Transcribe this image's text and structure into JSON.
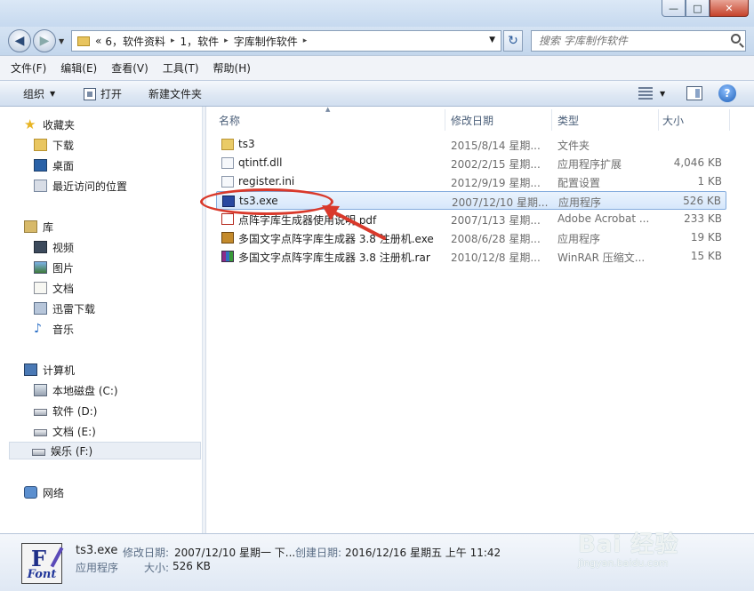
{
  "window": {
    "minimize_glyph": "—",
    "maximize_glyph": "□",
    "close_glyph": "✕"
  },
  "address": {
    "overflow": "«",
    "crumbs": [
      "6，软件资料",
      "1，软件",
      "字库制作软件"
    ],
    "separator": "▸"
  },
  "search": {
    "placeholder": "搜索 字库制作软件"
  },
  "menu": [
    "文件(F)",
    "编辑(E)",
    "查看(V)",
    "工具(T)",
    "帮助(H)"
  ],
  "toolbar": {
    "organize": "组织",
    "open": "打开",
    "new_folder": "新建文件夹",
    "help": "?"
  },
  "nav": {
    "favorites": "收藏夹",
    "downloads": "下载",
    "desktop": "桌面",
    "recent": "最近访问的位置",
    "libraries": "库",
    "videos": "视频",
    "pictures": "图片",
    "documents": "文档",
    "xunlei": "迅雷下载",
    "music": "音乐",
    "computer": "计算机",
    "drive_c": "本地磁盘 (C:)",
    "drive_d": "软件 (D:)",
    "drive_e": "文档 (E:)",
    "drive_f": "娱乐 (F:)",
    "network": "网络"
  },
  "columns": {
    "name": "名称",
    "date": "修改日期",
    "type": "类型",
    "size": "大小"
  },
  "files": [
    {
      "name": "ts3",
      "date": "2015/8/14 星期...",
      "type": "文件夹",
      "size": "",
      "icon": "folder-icon"
    },
    {
      "name": "qtintf.dll",
      "date": "2002/2/15 星期...",
      "type": "应用程序扩展",
      "size": "4,046 KB",
      "icon": "dll-icon"
    },
    {
      "name": "register.ini",
      "date": "2012/9/19 星期...",
      "type": "配置设置",
      "size": "1 KB",
      "icon": "ini-icon"
    },
    {
      "name": "ts3.exe",
      "date": "2007/12/10 星期...",
      "type": "应用程序",
      "size": "526 KB",
      "icon": "font-app-icon"
    },
    {
      "name": "点阵字库生成器使用说明.pdf",
      "date": "2007/1/13 星期...",
      "type": "Adobe Acrobat ...",
      "size": "233 KB",
      "icon": "pdf-icon"
    },
    {
      "name": "多国文字点阵字库生成器 3.8 注册机.exe",
      "date": "2008/6/28 星期...",
      "type": "应用程序",
      "size": "19 KB",
      "icon": "keygen-icon"
    },
    {
      "name": "多国文字点阵字库生成器 3.8 注册机.rar",
      "date": "2010/12/8 星期...",
      "type": "WinRAR 压缩文...",
      "size": "15 KB",
      "icon": "rar-icon"
    }
  ],
  "details": {
    "name": "ts3.exe",
    "modified_label": "修改日期:",
    "modified_value": "2007/12/10 星期一 下...",
    "created_label": "创建日期:",
    "created_value": "2016/12/16 星期五 上午 11:42",
    "type": "应用程序",
    "size_label": "大小:",
    "size_value": "526 KB",
    "icon_text": "Font"
  },
  "watermark": {
    "main": "Bai 经验",
    "sub": "jingyan.baidu.com"
  },
  "colors": {
    "selection_border": "#84acdd",
    "annotation": "#d9392b",
    "chrome": "#c9dbee"
  }
}
